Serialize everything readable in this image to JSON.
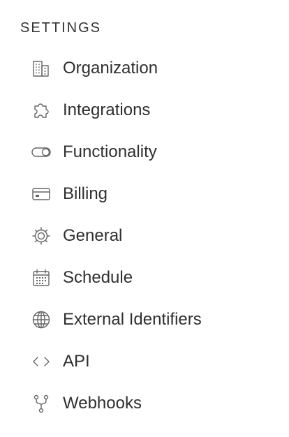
{
  "section": {
    "title": "SETTINGS"
  },
  "menu": {
    "items": [
      {
        "label": "Organization",
        "icon": "building-icon"
      },
      {
        "label": "Integrations",
        "icon": "puzzle-icon"
      },
      {
        "label": "Functionality",
        "icon": "toggle-icon"
      },
      {
        "label": "Billing",
        "icon": "credit-card-icon"
      },
      {
        "label": "General",
        "icon": "gear-icon"
      },
      {
        "label": "Schedule",
        "icon": "calendar-icon"
      },
      {
        "label": "External Identifiers",
        "icon": "globe-icon"
      },
      {
        "label": "API",
        "icon": "code-icon"
      },
      {
        "label": "Webhooks",
        "icon": "webhook-branch-icon"
      }
    ]
  },
  "colors": {
    "text": "#2f2f2f",
    "icon": "#666666",
    "background": "#ffffff"
  }
}
